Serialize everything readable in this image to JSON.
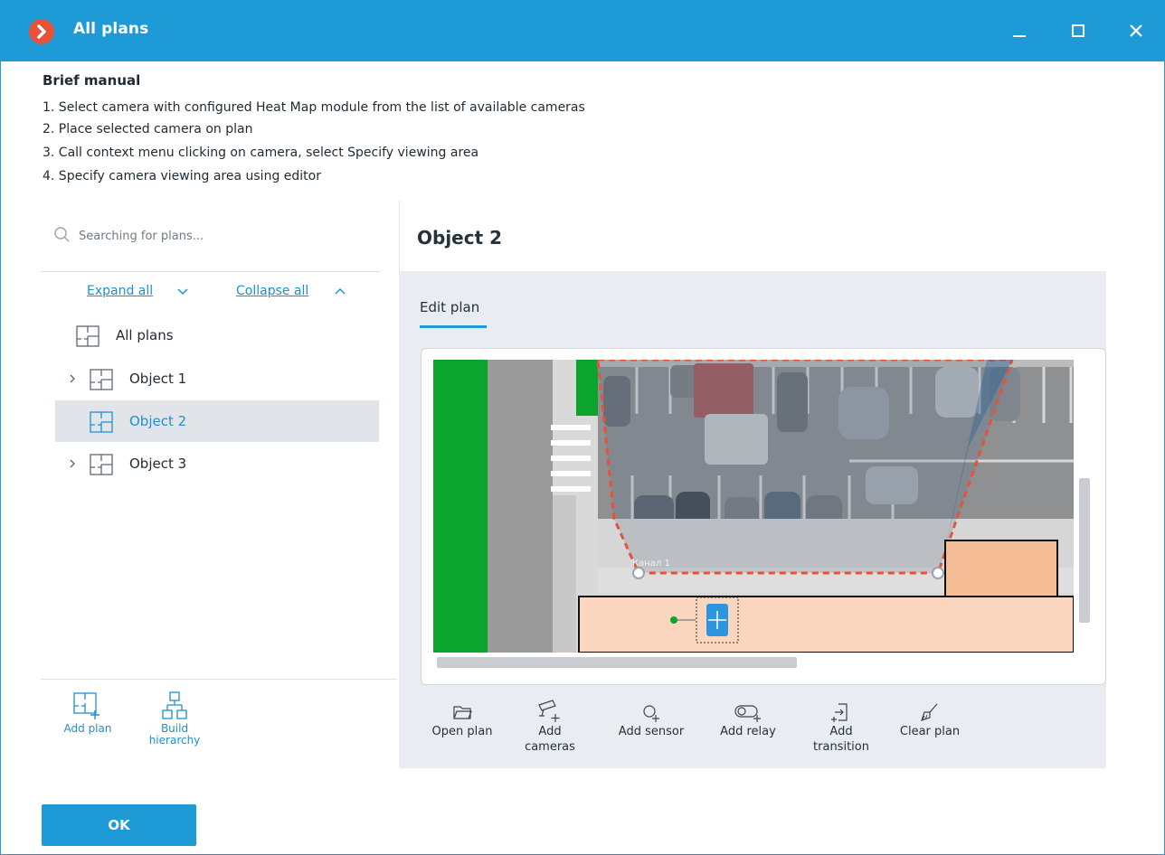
{
  "window": {
    "title": "All plans",
    "controls": [
      "minimize-icon",
      "maximize-icon",
      "close-icon"
    ]
  },
  "manual": {
    "title": "Brief manual",
    "steps": [
      "1. Select camera with configured Heat Map module from the list of available cameras",
      "2. Place selected camera on plan",
      "3. Call context menu clicking on camera, select Specify viewing area",
      "4. Specify camera viewing area using editor"
    ]
  },
  "sidebar": {
    "search_placeholder": "Searching for plans...",
    "expand_all": "Expand all",
    "collapse_all": "Collapse all",
    "tree": [
      {
        "label": "All plans",
        "expandable": false,
        "selected": false
      },
      {
        "label": "Object 1",
        "expandable": true,
        "selected": false
      },
      {
        "label": "Object 2",
        "expandable": false,
        "selected": true
      },
      {
        "label": "Object 3",
        "expandable": true,
        "selected": false
      }
    ],
    "actions": {
      "add_plan": "Add plan",
      "build_hierarchy_1": "Build",
      "build_hierarchy_2": "hierarchy"
    }
  },
  "main": {
    "title": "Object 2",
    "tab": "Edit plan",
    "plan_camera_label": "Канал 1",
    "toolbar": {
      "open_plan": "Open plan",
      "add_cameras_1": "Add",
      "add_cameras_2": "cameras",
      "add_sensor": "Add sensor",
      "add_relay": "Add relay",
      "add_transition_1": "Add",
      "add_transition_2": "transition",
      "clear_plan": "Clear plan"
    }
  },
  "footer": {
    "ok_label": "OK"
  },
  "colors": {
    "accent": "#1e9bd7",
    "link": "#1e8fd0",
    "logo": "#e8513a",
    "selection": "#e1e5ea",
    "panel_bg": "#e9ecf0"
  }
}
